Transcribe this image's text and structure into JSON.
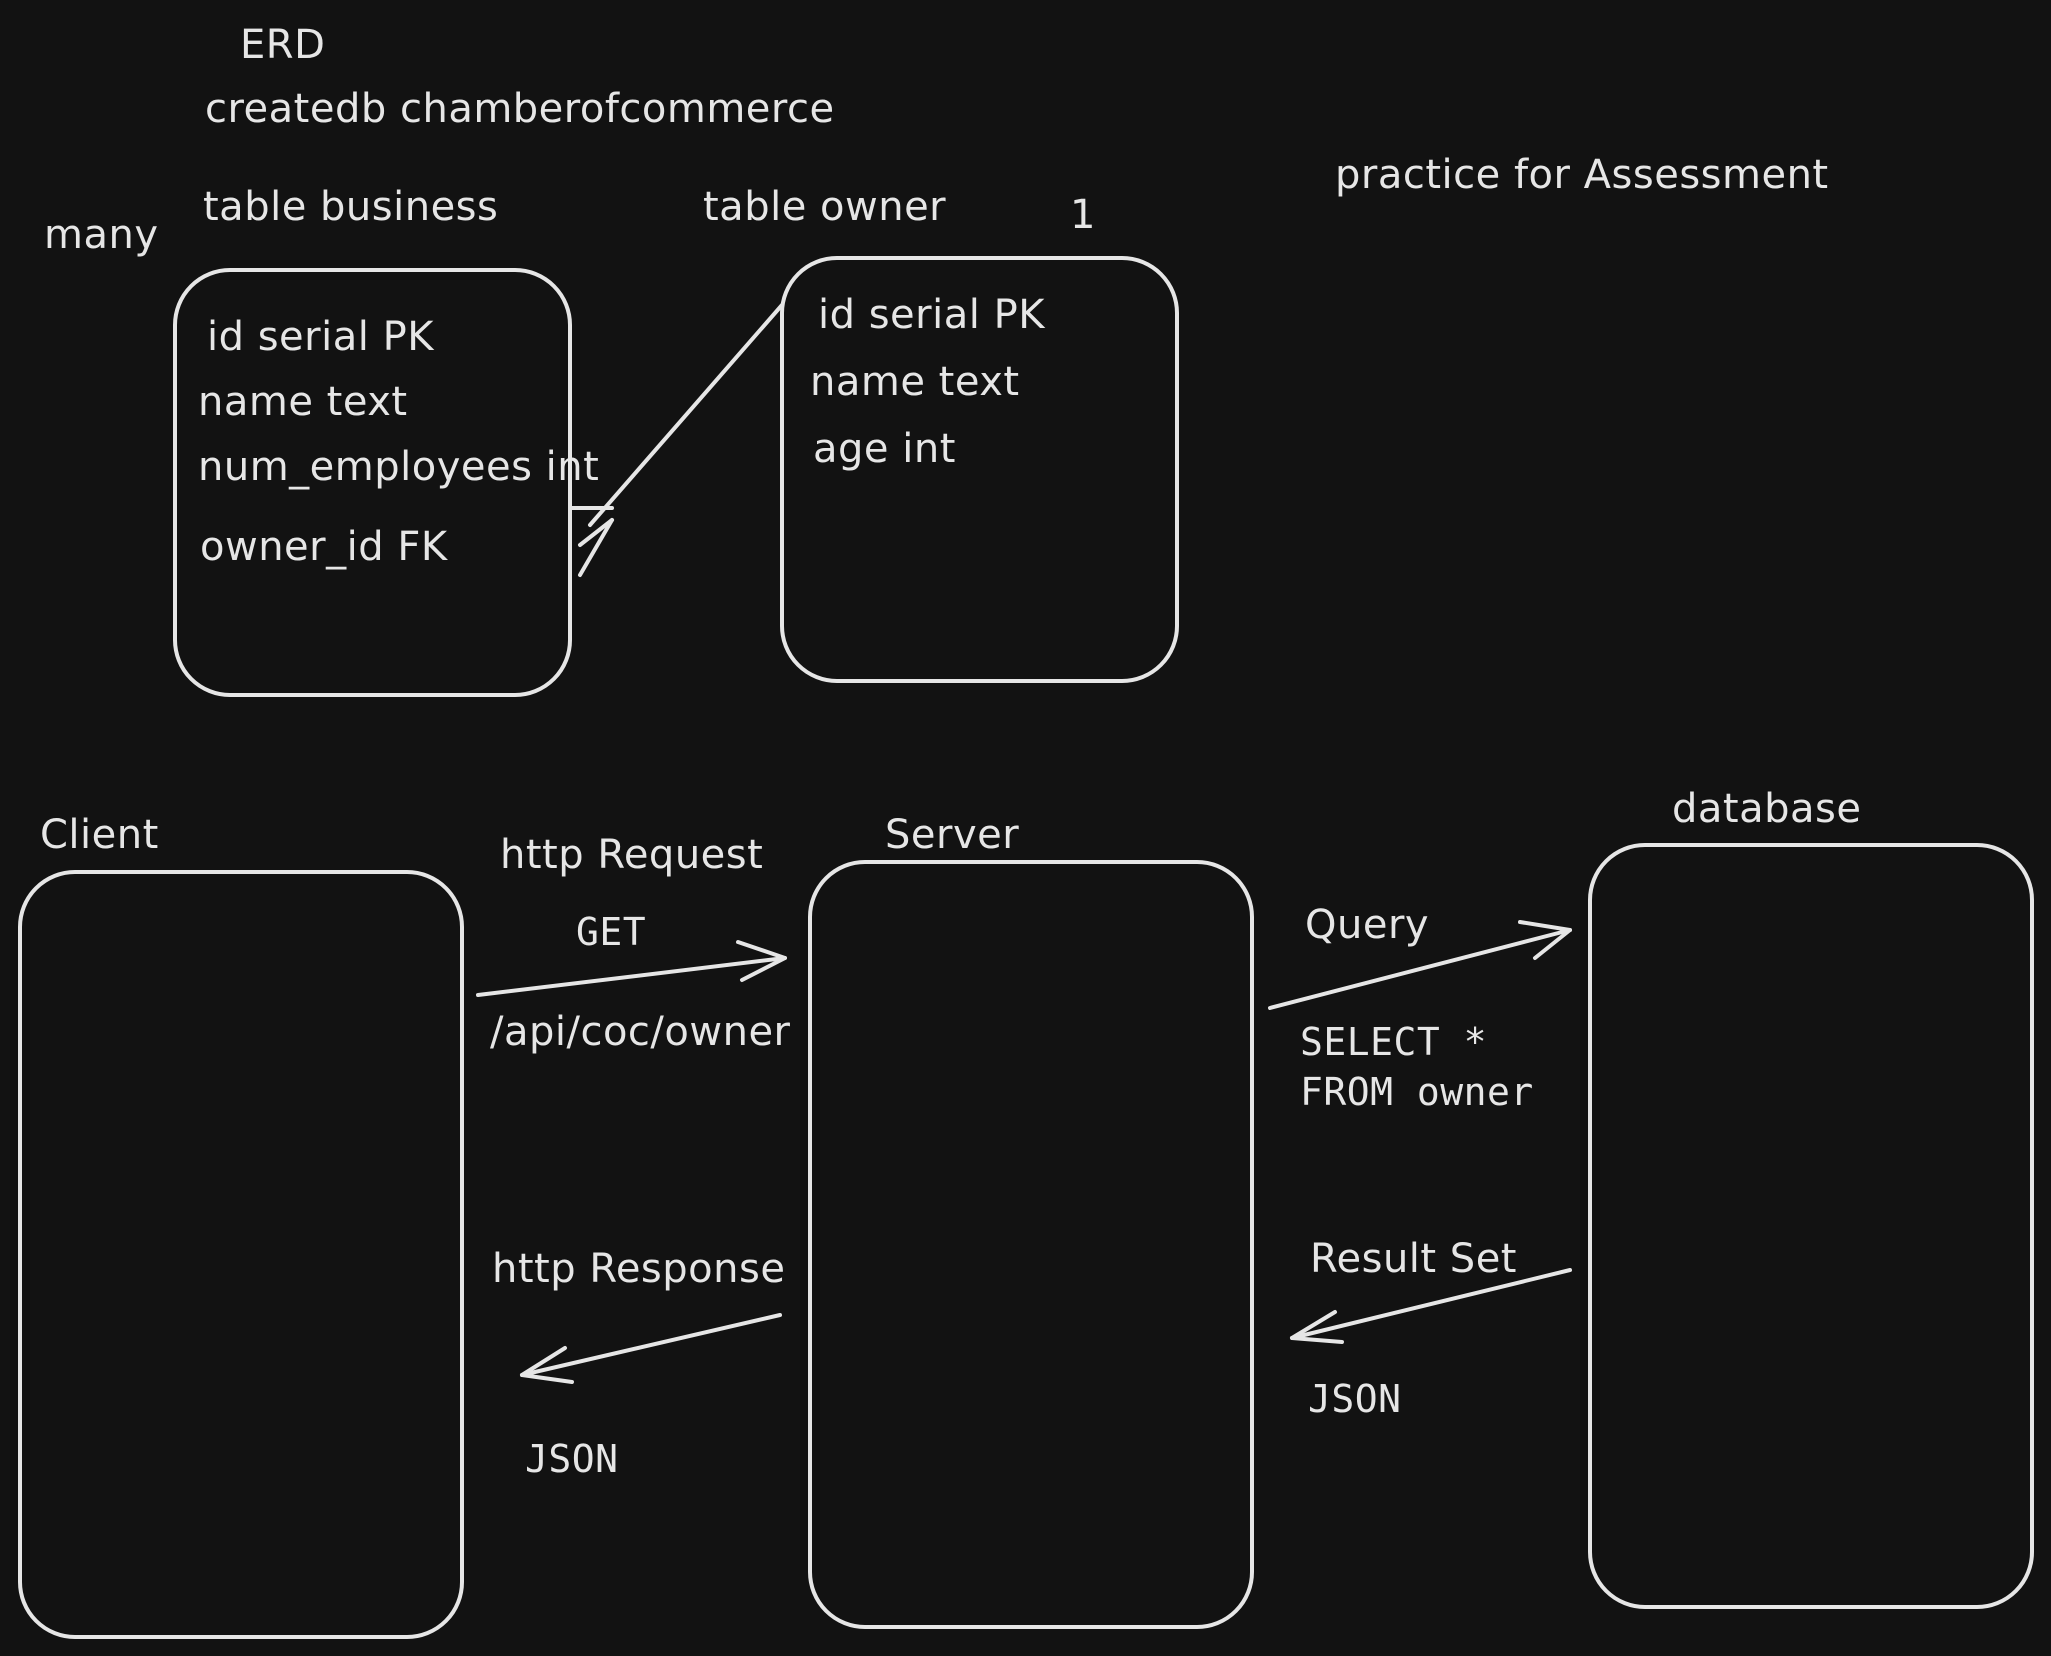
{
  "header": {
    "erd_label": "ERD",
    "createdb_command": "createdb chamberofcommerce",
    "practice_note": "practice for Assessment"
  },
  "erd": {
    "business_table": {
      "title": "table business",
      "cardinality": "many",
      "fields": [
        "id serial PK",
        "name text",
        "num_employees int",
        "owner_id FK"
      ]
    },
    "owner_table": {
      "title": "table owner",
      "cardinality": "1",
      "fields": [
        "id serial PK",
        "name text",
        "age int"
      ]
    }
  },
  "flow": {
    "client_label": "Client",
    "server_label": "Server",
    "database_label": "database",
    "request": {
      "label": "http Request",
      "method": "GET",
      "path": "/api/coc/owner"
    },
    "query": {
      "label": "Query",
      "sql_line1": "SELECT *",
      "sql_line2": "FROM owner"
    },
    "result": {
      "label": "Result Set",
      "format": "JSON"
    },
    "response": {
      "label": "http Response",
      "format": "JSON"
    }
  }
}
